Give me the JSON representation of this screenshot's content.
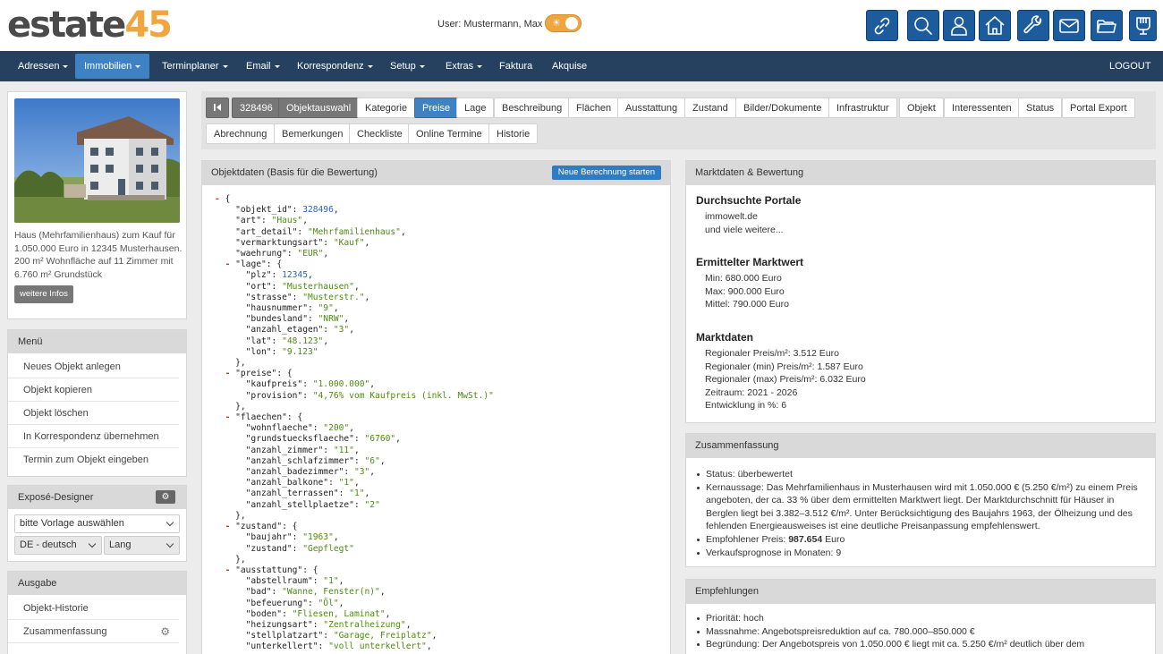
{
  "brand": {
    "logo_part1": "estate",
    "logo_part2": "45"
  },
  "header": {
    "user_label": "User: Mustermann, Max",
    "quick_icons": [
      "link-icon",
      "search-icon",
      "user-icon",
      "home-icon",
      "wrench-icon",
      "mail-icon",
      "folder-icon",
      "cup-icon"
    ]
  },
  "nav": {
    "items": [
      {
        "label": "Adressen",
        "dropdown": true
      },
      {
        "label": "Immobilien",
        "dropdown": true,
        "active": true
      },
      {
        "label": "Terminplaner",
        "dropdown": true
      },
      {
        "label": "Email",
        "dropdown": true
      },
      {
        "label": "Korrespondenz",
        "dropdown": true
      },
      {
        "label": "Setup",
        "dropdown": true
      },
      {
        "label": "Extras",
        "dropdown": true
      },
      {
        "label": "Faktura",
        "dropdown": false
      },
      {
        "label": "Akquise",
        "dropdown": false
      }
    ],
    "logout": "LOGOUT"
  },
  "listing": {
    "description": "Haus (Mehrfamilienhaus) zum Kauf für 1.050.000 Euro in 12345 Musterhausen. 200 m² Wohnfläche auf 11 Zimmer mit 6.760 m² Grundstück",
    "more_button": "weitere Infos"
  },
  "menu": {
    "title": "Menü",
    "items": [
      "Neues Objekt anlegen",
      "Objekt kopieren",
      "Objekt löschen",
      "In Korrespondenz übernehmen",
      "Termin zum Objekt eingeben"
    ]
  },
  "expose": {
    "title": "Exposé-Designer",
    "template_select": "bitte Vorlage auswählen",
    "language_select": "DE - deutsch",
    "length_select": "Lang"
  },
  "output": {
    "title": "Ausgabe",
    "items": [
      "Objekt-Historie",
      "Zusammenfassung"
    ]
  },
  "tabs": {
    "first_icon": "first-page-icon",
    "object_id": "328496",
    "object_select": "Objektauswahl",
    "row1": [
      "Kategorie",
      "Preise",
      "Lage",
      "Beschreibung",
      "Flächen",
      "Ausstattung",
      "Zustand",
      "Bilder/Dokumente",
      "Infrastruktur",
      "Objekt",
      "Interessenten",
      "Status",
      "Portal Export"
    ],
    "row2": [
      "Abrechnung",
      "Bemerkungen",
      "Checkliste",
      "Online Termine",
      "Historie"
    ],
    "active": "Preise"
  },
  "objektdaten": {
    "title": "Objektdaten (Basis für die Bewertung)",
    "button": "Neue Berechnung starten",
    "json_lines": [
      [
        "- ",
        "{"
      ],
      [
        "    ",
        "\"objekt_id\": ",
        "n:328496",
        ","
      ],
      [
        "    ",
        "\"art\": ",
        "s:\"Haus\"",
        ","
      ],
      [
        "    ",
        "\"art_detail\": ",
        "s:\"Mehrfamilienhaus\"",
        ","
      ],
      [
        "    ",
        "\"vermarktungsart\": ",
        "s:\"Kauf\"",
        ","
      ],
      [
        "    ",
        "\"waehrung\": ",
        "s:\"EUR\"",
        ","
      ],
      [
        "  - ",
        "\"lage\": {"
      ],
      [
        "      ",
        "\"plz\": ",
        "n:12345",
        ","
      ],
      [
        "      ",
        "\"ort\": ",
        "s:\"Musterhausen\"",
        ","
      ],
      [
        "      ",
        "\"strasse\": ",
        "s:\"Musterstr.\"",
        ","
      ],
      [
        "      ",
        "\"hausnummer\": ",
        "s:\"9\"",
        ","
      ],
      [
        "      ",
        "\"bundesland\": ",
        "s:\"NRW\"",
        ","
      ],
      [
        "      ",
        "\"anzahl_etagen\": ",
        "s:\"3\"",
        ","
      ],
      [
        "      ",
        "\"lat\": ",
        "s:\"48.123\"",
        ","
      ],
      [
        "      ",
        "\"lon\": ",
        "s:\"9.123\""
      ],
      [
        "    ",
        "},"
      ],
      [
        "  - ",
        "\"preise\": {"
      ],
      [
        "      ",
        "\"kaufpreis\": ",
        "s:\"1.000.000\"",
        ","
      ],
      [
        "      ",
        "\"provision\": ",
        "s:\"4,76% vom Kaufpreis (inkl. MwSt.)\""
      ],
      [
        "    ",
        "},"
      ],
      [
        "  - ",
        "\"flaechen\": {"
      ],
      [
        "      ",
        "\"wohnflaeche\": ",
        "s:\"200\"",
        ","
      ],
      [
        "      ",
        "\"grundstuecksflaeche\": ",
        "s:\"6760\"",
        ","
      ],
      [
        "      ",
        "\"anzahl_zimmer\": ",
        "s:\"11\"",
        ","
      ],
      [
        "      ",
        "\"anzahl_schlafzimmer\": ",
        "s:\"6\"",
        ","
      ],
      [
        "      ",
        "\"anzahl_badezimmer\": ",
        "s:\"3\"",
        ","
      ],
      [
        "      ",
        "\"anzahl_balkone\": ",
        "s:\"1\"",
        ","
      ],
      [
        "      ",
        "\"anzahl_terrassen\": ",
        "s:\"1\"",
        ","
      ],
      [
        "      ",
        "\"anzahl_stellplaetze\": ",
        "s:\"2\""
      ],
      [
        "    ",
        "},"
      ],
      [
        "  - ",
        "\"zustand\": {"
      ],
      [
        "      ",
        "\"baujahr\": ",
        "s:\"1963\"",
        ","
      ],
      [
        "      ",
        "\"zustand\": ",
        "s:\"Gepflegt\""
      ],
      [
        "    ",
        "},"
      ],
      [
        "  - ",
        "\"ausstattung\": {"
      ],
      [
        "      ",
        "\"abstellraum\": ",
        "s:\"1\"",
        ","
      ],
      [
        "      ",
        "\"bad\": ",
        "s:\"Wanne, Fenster(n)\"",
        ","
      ],
      [
        "      ",
        "\"befeuerung\": ",
        "s:\"Öl\"",
        ","
      ],
      [
        "      ",
        "\"boden\": ",
        "s:\"Fliesen, Laminat\"",
        ","
      ],
      [
        "      ",
        "\"heizungsart\": ",
        "s:\"Zentralheizung\"",
        ","
      ],
      [
        "      ",
        "\"stellplatzart\": ",
        "s:\"Garage, Freiplatz\"",
        ","
      ],
      [
        "      ",
        "\"unterkellert\": ",
        "s:\"voll unterkellert\"",
        ","
      ]
    ]
  },
  "marktdaten": {
    "title": "Marktdaten & Bewertung",
    "portals_title": "Durchsuchte Portale",
    "portals": [
      "immowelt.de",
      "und viele weitere..."
    ],
    "value_title": "Ermittelter Marktwert",
    "values": [
      "Min: 680.000 Euro",
      "Max: 900.000 Euro",
      "Mittel: 790.000 Euro"
    ],
    "market_title": "Marktdaten",
    "market": [
      "Regionaler Preis/m²: 3.512 Euro",
      "Regionaler (min) Preis/m²: 1.587 Euro",
      "Regionaler (max) Preis/m²: 6.032 Euro",
      "Zeitraum: 2021 - 2026",
      "Entwicklung in %: 6"
    ]
  },
  "summary": {
    "title": "Zusammenfassung",
    "status": "Status: überbewertet",
    "statement": "Kernaussage: Das Mehrfamilienhaus in Musterhausen wird mit 1.050.000 € (5.250 €/m²) zu einem Preis angeboten, der ca. 33 % über dem ermittelten Marktwert liegt. Der Marktdurchschnitt für Häuser in Berglen liegt bei 3.382–3.512 €/m². Unter Berücksichtigung des Baujahrs 1963, der Ölheizung und des fehlenden Energieausweises ist eine deutliche Preisanpassung empfehlenswert.",
    "price_label": "Empfohlener Preis:",
    "price_value": "987.654",
    "price_unit": "Euro",
    "forecast": "Verkaufsprognose in Monaten: 9"
  },
  "recommendations": {
    "title": "Empfehlungen",
    "items": [
      "Priorität: hoch",
      "Massnahme: Angebotspreisreduktion auf ca. 780.000–850.000 €",
      "Begründung: Der Angebotspreis von 1.050.000 € liegt mit ca. 5.250 €/m² deutlich über dem"
    ]
  },
  "colors": {
    "brand_orange": "#f0a640",
    "nav_bg": "#25415f",
    "accent_blue": "#3e82c4",
    "icon_button": "#1c5c9c"
  }
}
